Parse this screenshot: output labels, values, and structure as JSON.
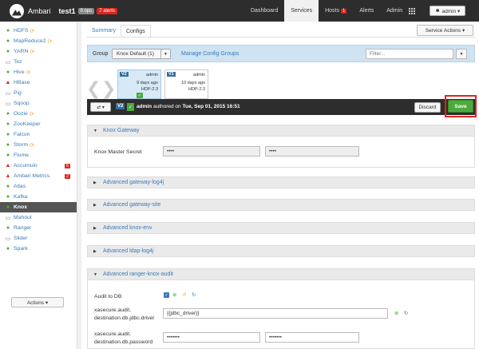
{
  "topbar": {
    "brand": "Ambari",
    "cluster": "test1",
    "ops_badge": "0 ops",
    "alerts_badge": "7 alerts",
    "nav": [
      {
        "label": "Dashboard"
      },
      {
        "label": "Services"
      },
      {
        "label": "Hosts",
        "badge": "1"
      },
      {
        "label": "Alerts"
      },
      {
        "label": "Admin"
      }
    ],
    "user_button": "admin ▾"
  },
  "sidebar": {
    "services": [
      {
        "label": "HDFS",
        "status": "ok",
        "refresh": true
      },
      {
        "label": "MapReduce2",
        "status": "ok",
        "refresh": true
      },
      {
        "label": "YARN",
        "status": "ok",
        "refresh": true
      },
      {
        "label": "Tez",
        "status": "client"
      },
      {
        "label": "Hive",
        "status": "ok",
        "refresh": true
      },
      {
        "label": "HBase",
        "status": "alert"
      },
      {
        "label": "Pig",
        "status": "client"
      },
      {
        "label": "Sqoop",
        "status": "client"
      },
      {
        "label": "Oozie",
        "status": "ok",
        "refresh": true
      },
      {
        "label": "ZooKeeper",
        "status": "ok"
      },
      {
        "label": "Falcon",
        "status": "ok"
      },
      {
        "label": "Storm",
        "status": "ok",
        "refresh": true
      },
      {
        "label": "Flume",
        "status": "ok"
      },
      {
        "label": "Accumulo",
        "status": "alert",
        "count": "5"
      },
      {
        "label": "Ambari Metrics",
        "status": "alert",
        "count": "2"
      },
      {
        "label": "Atlas",
        "status": "ok"
      },
      {
        "label": "Kafka",
        "status": "ok"
      },
      {
        "label": "Knox",
        "status": "ok",
        "active": true
      },
      {
        "label": "Mahout",
        "status": "client"
      },
      {
        "label": "Ranger",
        "status": "ok"
      },
      {
        "label": "Slider",
        "status": "client"
      },
      {
        "label": "Spark",
        "status": "ok"
      }
    ],
    "actions_label": "Actions ▾"
  },
  "main": {
    "tabs": [
      {
        "label": "Summary"
      },
      {
        "label": "Configs"
      }
    ],
    "service_actions": "Service Actions ▾",
    "group_label": "Group",
    "group_value": "Knox Default (1)",
    "manage_link": "Manage Config Groups",
    "filter_placeholder": "Filter...",
    "versions": [
      {
        "tag": "V2",
        "author": "admin",
        "time": "9 days ago",
        "stack": "HDP-2.3",
        "current": true
      },
      {
        "tag": "V1",
        "author": "admin",
        "time": "10 days ago",
        "stack": "HDP-2.3",
        "current": false
      }
    ],
    "version_bar": {
      "tag": "V2",
      "author": "admin",
      "authored_text": "authored on",
      "date": "Tue, Sep 01, 2015 16:51",
      "discard_label": "Discard",
      "save_label": "Save"
    },
    "sections": {
      "knox_gateway": {
        "title": "Knox Gateway",
        "master_secret_label": "Knox Master Secret",
        "master_secret_value": "••••",
        "master_secret_confirm": "••••"
      },
      "collapsed": [
        {
          "title": "Advanced gateway-log4j"
        },
        {
          "title": "Advanced gateway-site"
        },
        {
          "title": "Advanced knox-env"
        },
        {
          "title": "Advanced ldap-log4j"
        }
      ],
      "ranger_audit": {
        "title": "Advanced ranger-knox-audit",
        "audit_db_label": "Audit to DB",
        "jdbc_driver_label_1": "xasecure.audit.",
        "jdbc_driver_label_2": "destination.db.jdbc.driver",
        "jdbc_driver_value": "{{jdbc_driver}}",
        "password_label_1": "xasecure.audit.",
        "password_label_2": "destination.db.password",
        "password_value": "•••••••",
        "password_confirm": "•••••••"
      }
    }
  }
}
